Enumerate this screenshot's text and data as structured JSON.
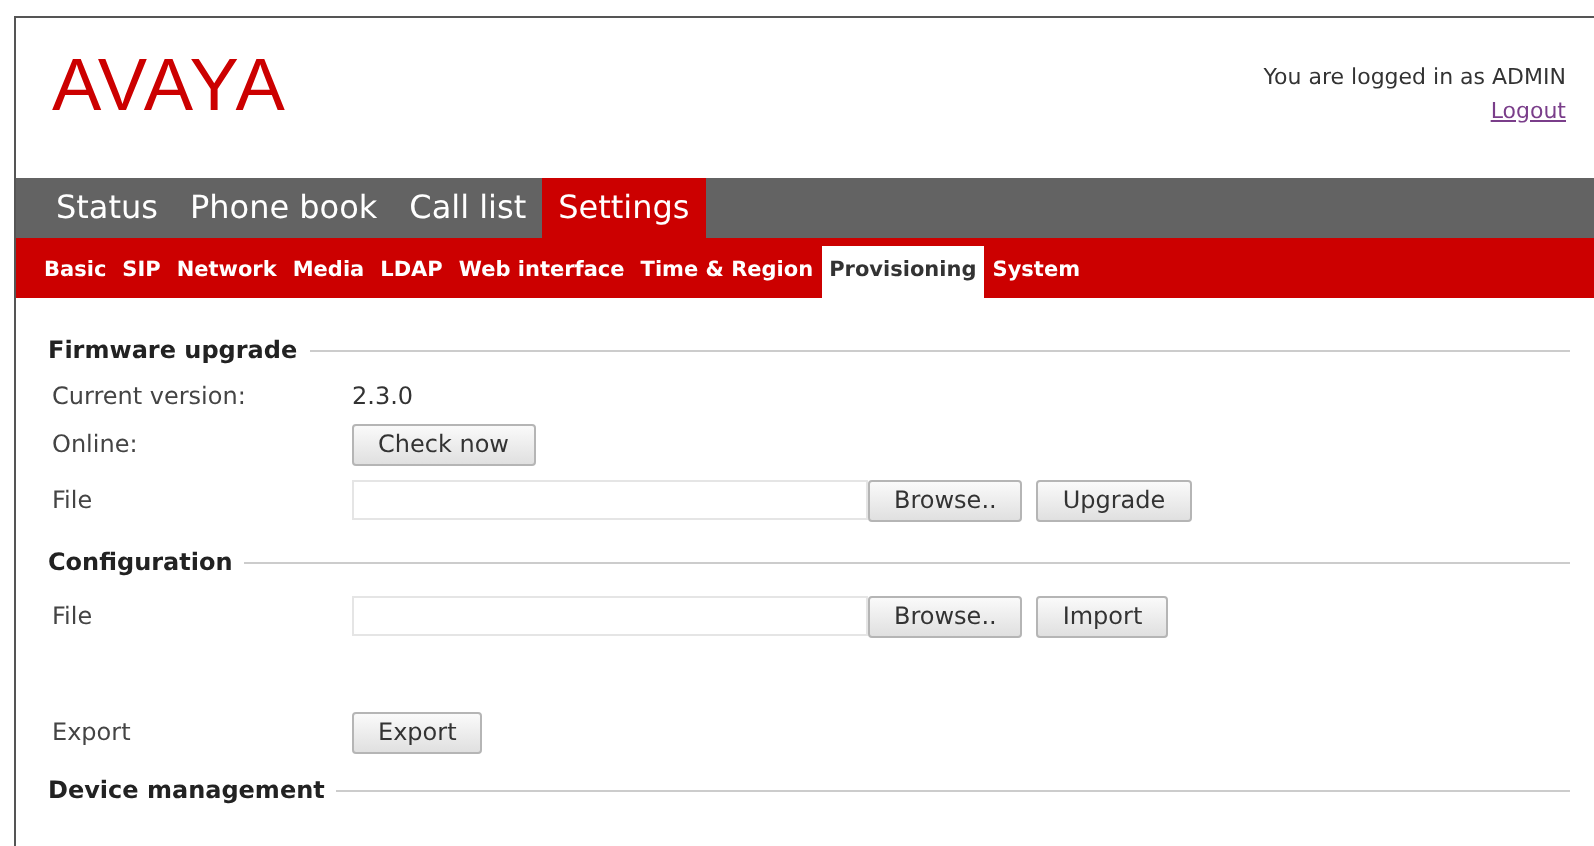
{
  "header": {
    "logo": "AVAYA",
    "login_text": "You are logged in as ADMIN",
    "logout_link": "Logout"
  },
  "main_tabs": [
    {
      "label": "Status",
      "selected": false
    },
    {
      "label": "Phone book",
      "selected": false
    },
    {
      "label": "Call list",
      "selected": false
    },
    {
      "label": "Settings",
      "selected": true
    }
  ],
  "sub_tabs": [
    {
      "label": "Basic",
      "selected": false
    },
    {
      "label": "SIP",
      "selected": false
    },
    {
      "label": "Network",
      "selected": false
    },
    {
      "label": "Media",
      "selected": false
    },
    {
      "label": "LDAP",
      "selected": false
    },
    {
      "label": "Web interface",
      "selected": false
    },
    {
      "label": "Time & Region",
      "selected": false
    },
    {
      "label": "Provisioning",
      "selected": true
    },
    {
      "label": "System",
      "selected": false
    }
  ],
  "sections": [
    {
      "title": "Firmware upgrade",
      "rows": [
        {
          "kind": "text",
          "label": "Current version:",
          "value": "2.3.0"
        },
        {
          "kind": "button",
          "label": "Online:",
          "buttons": [
            "Check now"
          ]
        },
        {
          "kind": "file",
          "label": "File",
          "buttons": [
            "Browse..",
            "Upgrade"
          ]
        }
      ]
    },
    {
      "title": "Configuration",
      "rows": [
        {
          "kind": "file",
          "label": "File",
          "buttons": [
            "Browse..",
            "Import"
          ]
        },
        {
          "kind": "spacer"
        },
        {
          "kind": "button",
          "label": "Export",
          "buttons": [
            "Export"
          ]
        }
      ]
    },
    {
      "title": "Device management"
    }
  ]
}
